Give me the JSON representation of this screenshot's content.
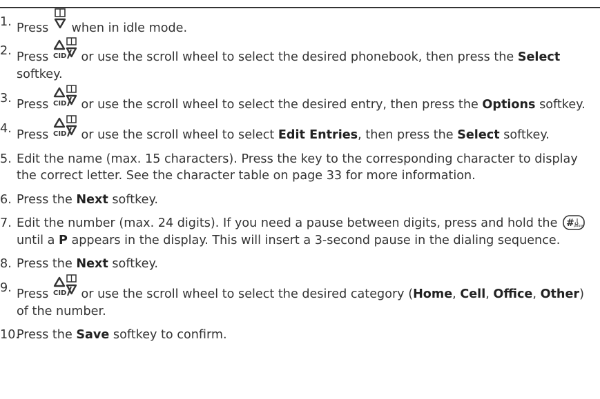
{
  "steps": [
    {
      "num": "1.",
      "parts": [
        "Press ",
        "",
        " when in idle mode."
      ]
    },
    {
      "num": "2.",
      "parts": [
        "Press ",
        "",
        " or use the scroll wheel to select the desired phonebook, then press the ",
        "Select",
        " softkey."
      ]
    },
    {
      "num": "3.",
      "parts": [
        "Press ",
        "",
        " or use the scroll wheel to select the desired entry, then press the ",
        "Options",
        " softkey."
      ]
    },
    {
      "num": "4.",
      "parts": [
        "Press ",
        "",
        " or use the scroll wheel to select ",
        "Edit Entries",
        ", then press the ",
        "Select",
        " softkey."
      ]
    },
    {
      "num": "5.",
      "parts": [
        "Edit the name (max. 15 characters). Press the key to the corresponding character to display the correct letter. See the character table on page 33 for more information."
      ]
    },
    {
      "num": "6.",
      "parts": [
        "Press the ",
        "Next",
        " softkey."
      ]
    },
    {
      "num": "7.",
      "parts": [
        "Edit the number (max. 24 digits). If you need a pause between digits, press and hold the ",
        "",
        " until a ",
        "P",
        " appears in the display. This will insert a 3-second pause in the dialing sequence."
      ]
    },
    {
      "num": "8.",
      "parts": [
        "Press the ",
        "Next",
        " softkey."
      ]
    },
    {
      "num": "9.",
      "parts": [
        "Press ",
        "",
        " or use the scroll wheel to select the desired category (",
        "Home",
        ", ",
        "Cell",
        ", ",
        "Office",
        ", ",
        "Other",
        ") of the number."
      ]
    },
    {
      "num": "10.",
      "parts": [
        "Press the ",
        "Save",
        " softkey to confirm."
      ]
    }
  ],
  "keys": {
    "cid_label": "CID",
    "pause_label": "#",
    "pause_sub": "pause"
  }
}
